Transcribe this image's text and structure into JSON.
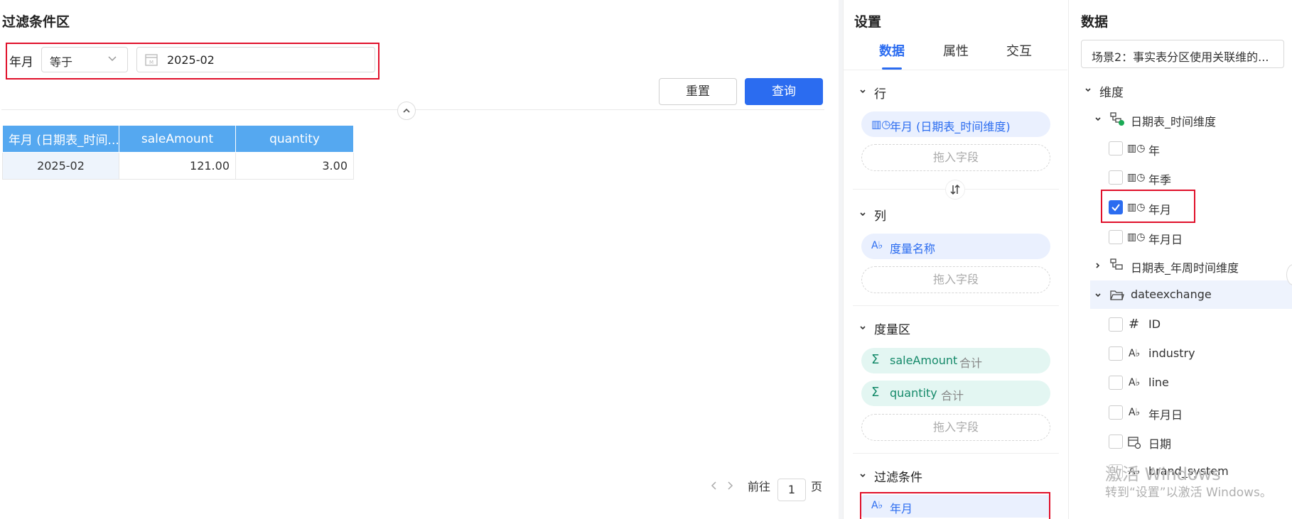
{
  "filter_panel": {
    "title": "过滤条件区",
    "field_label": "年月",
    "operator": "等于",
    "date_value": "2025-02",
    "reset_label": "重置",
    "query_label": "查询"
  },
  "table": {
    "columns": [
      "年月 (日期表_时间...",
      "saleAmount",
      "quantity"
    ],
    "rows": [
      [
        "2025-02",
        "121.00",
        "3.00"
      ]
    ]
  },
  "pagination": {
    "goto_label": "前往",
    "page": "1",
    "page_suffix": "页"
  },
  "settings": {
    "title": "设置",
    "tabs": [
      "数据",
      "属性",
      "交互"
    ],
    "active_tab": 0,
    "rows_section": {
      "label": "行",
      "fields": [
        "年月 (日期表_时间维度)"
      ],
      "drop": "拖入字段"
    },
    "cols_section": {
      "label": "列",
      "fields": [
        "度量名称"
      ],
      "drop": "拖入字段"
    },
    "measure_section": {
      "label": "度量区",
      "fields": [
        {
          "name": "saleAmount",
          "agg": "合计"
        },
        {
          "name": "quantity",
          "agg": "合计"
        }
      ],
      "drop": "拖入字段"
    },
    "filter_section": {
      "label": "过滤条件",
      "fields": [
        "年月"
      ]
    }
  },
  "data_panel": {
    "title": "数据",
    "dataset": "场景2：事实表分区使用关联维的...",
    "dimension_label": "维度",
    "tree": [
      {
        "label": "日期表_时间维度",
        "level": 1,
        "type": "hierarchy",
        "expanded": true
      },
      {
        "label": "年",
        "level": 2,
        "type": "date",
        "checked": false
      },
      {
        "label": "年季",
        "level": 2,
        "type": "date",
        "checked": false
      },
      {
        "label": "年月",
        "level": 2,
        "type": "date",
        "checked": true
      },
      {
        "label": "年月日",
        "level": 2,
        "type": "date",
        "checked": false
      },
      {
        "label": "日期表_年周时间维度",
        "level": 1,
        "type": "hierarchy",
        "expanded": false
      },
      {
        "label": "dateexchange",
        "level": 1,
        "type": "folder",
        "expanded": true
      },
      {
        "label": "ID",
        "level": 2,
        "type": "number",
        "checked": false
      },
      {
        "label": "industry",
        "level": 2,
        "type": "text",
        "checked": false
      },
      {
        "label": "line",
        "level": 2,
        "type": "text",
        "checked": false
      },
      {
        "label": "年月日",
        "level": 2,
        "type": "text",
        "checked": false
      },
      {
        "label": "日期",
        "level": 2,
        "type": "calendar",
        "checked": false
      },
      {
        "label": "brand_system",
        "level": 2,
        "type": "text",
        "checked": false
      }
    ]
  },
  "watermark": {
    "line1": "激活 Windows",
    "line2": "转到“设置”以激活 Windows。"
  },
  "colors": {
    "primary": "#2b6cf0",
    "header": "#55a8f0",
    "highlight_red": "#e0102a",
    "measure_green": "#158a6a"
  }
}
